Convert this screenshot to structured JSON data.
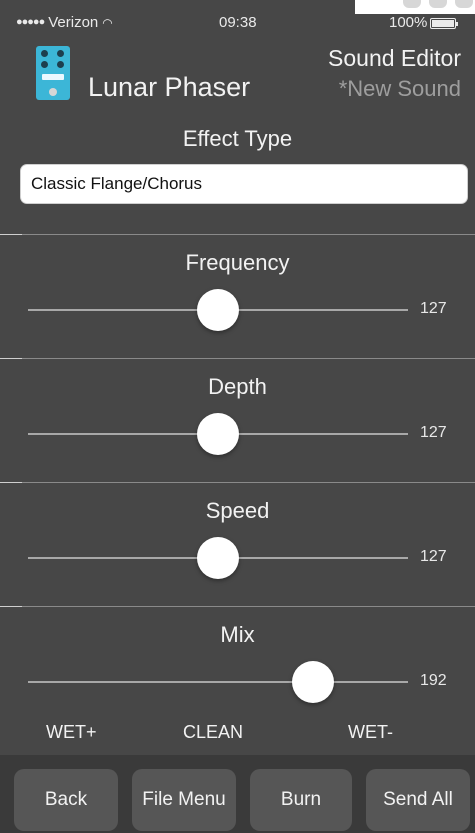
{
  "status_bar": {
    "carrier": "Verizon",
    "time": "09:38",
    "battery": "100%"
  },
  "header": {
    "app_title": "Lunar Phaser",
    "section_title": "Sound Editor",
    "subtitle": "*New Sound"
  },
  "effect": {
    "label": "Effect Type",
    "value": "Classic Flange/Chorus"
  },
  "sliders": [
    {
      "label": "Frequency",
      "value": "127",
      "level": 0.5
    },
    {
      "label": "Depth",
      "value": "127",
      "level": 0.5
    },
    {
      "label": "Speed",
      "value": "127",
      "level": 0.5
    },
    {
      "label": "Mix",
      "value": "192",
      "level": 0.75
    }
  ],
  "mix_scale": {
    "left": "WET+",
    "center": "CLEAN",
    "right": "WET-"
  },
  "toolbar": {
    "back": "Back",
    "file_menu": "File Menu",
    "burn": "Burn",
    "send_all": "Send All"
  },
  "colors": {
    "background": "#474747",
    "toolbar": "#3a3a3a",
    "pedal": "#3cb6d7",
    "subtitle": "#9e9e9e"
  }
}
